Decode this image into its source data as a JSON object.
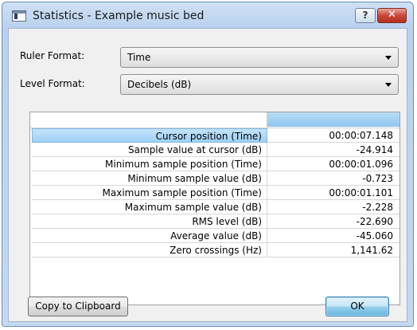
{
  "window": {
    "title": "Statistics - Example music bed",
    "help_label": "?",
    "close_label": "✕"
  },
  "form": {
    "ruler_format_label": "Ruler Format:",
    "ruler_format_value": "Time",
    "level_format_label": "Level Format:",
    "level_format_value": "Decibels (dB)"
  },
  "stats": {
    "rows": [
      {
        "label": "Cursor position (Time)",
        "value": "00:00:07.148"
      },
      {
        "label": "Sample value at cursor (dB)",
        "value": "-24.914"
      },
      {
        "label": "Minimum sample position (Time)",
        "value": "00:00:01.096"
      },
      {
        "label": "Minimum sample value (dB)",
        "value": "-0.723"
      },
      {
        "label": "Maximum sample position (Time)",
        "value": "00:00:01.101"
      },
      {
        "label": "Maximum sample value (dB)",
        "value": "-2.228"
      },
      {
        "label": "RMS level (dB)",
        "value": "-22.690"
      },
      {
        "label": "Average value (dB)",
        "value": "-45.060"
      },
      {
        "label": "Zero crossings (Hz)",
        "value": "1,141.62"
      }
    ]
  },
  "buttons": {
    "copy_label": "Copy to Clipboard",
    "ok_label": "OK"
  }
}
